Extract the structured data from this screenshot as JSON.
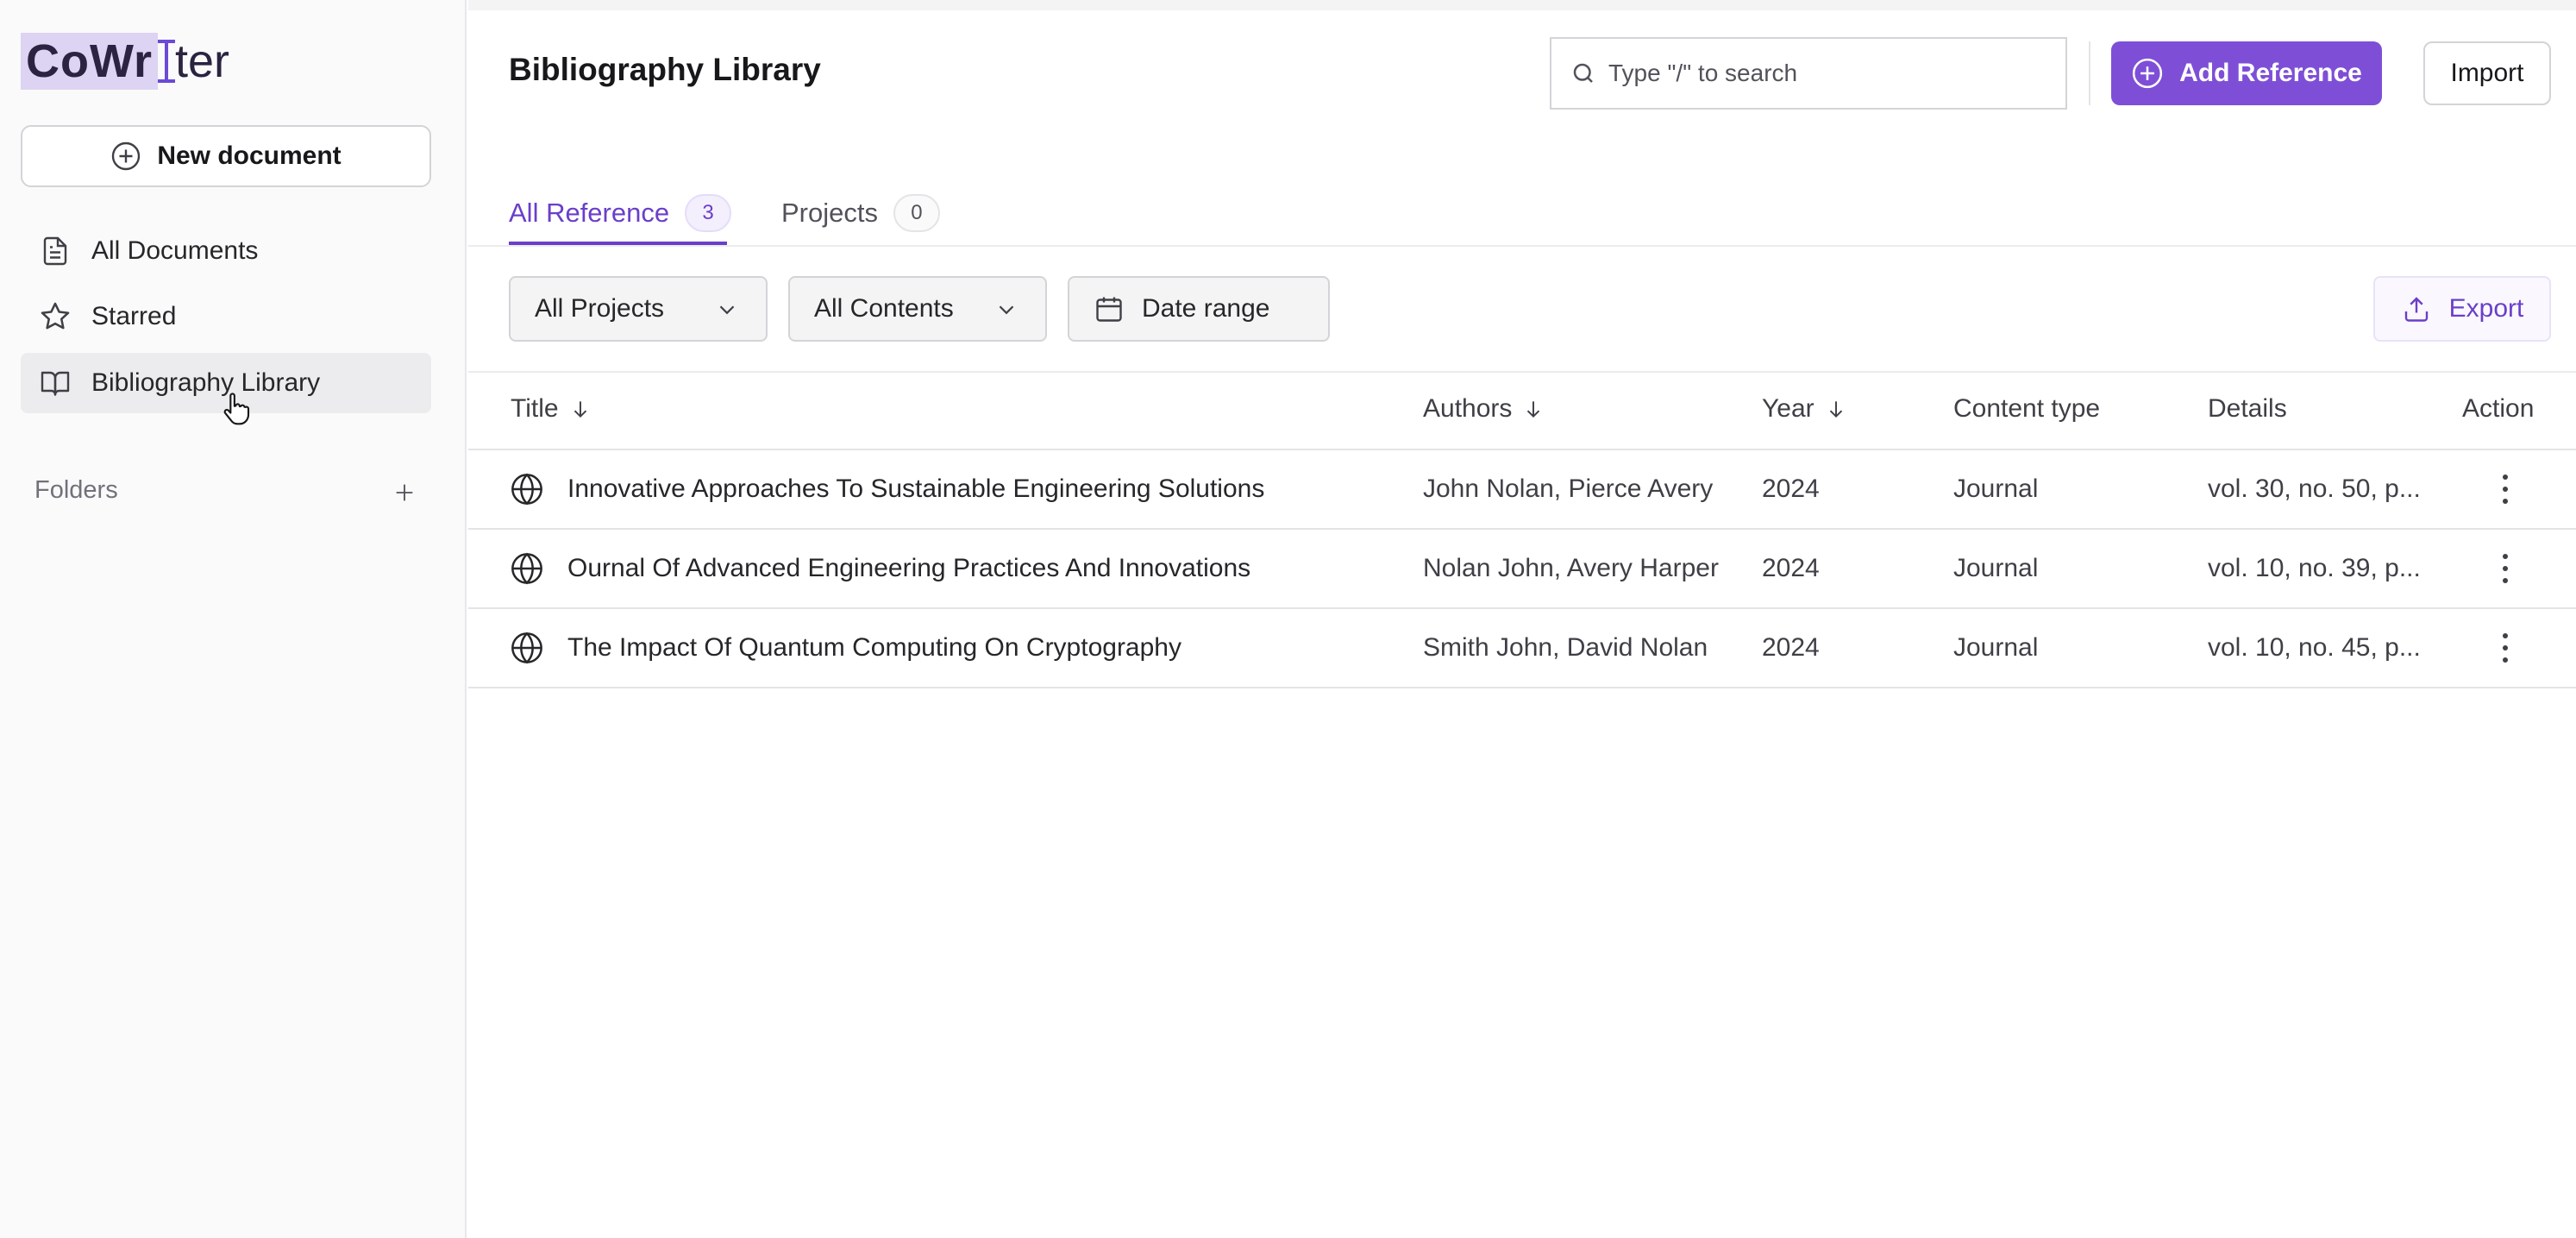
{
  "app": {
    "logo_highlight": "CoWr",
    "logo_rest": "ter"
  },
  "sidebar": {
    "new_document": "New document",
    "items": [
      {
        "label": "All Documents",
        "icon": "document-icon"
      },
      {
        "label": "Starred",
        "icon": "star-icon"
      },
      {
        "label": "Bibliography Library",
        "icon": "book-icon",
        "active": true
      }
    ],
    "folders_label": "Folders"
  },
  "header": {
    "title": "Bibliography Library",
    "search_placeholder": "Type \"/\" to search",
    "add_reference": "Add Reference",
    "import": "Import"
  },
  "tabs": [
    {
      "label": "All Reference",
      "count": "3",
      "active": true
    },
    {
      "label": "Projects",
      "count": "0",
      "active": false
    }
  ],
  "filters": {
    "projects": "All Projects",
    "contents": "All Contents",
    "date_range": "Date range",
    "export": "Export"
  },
  "table": {
    "columns": {
      "title": "Title",
      "authors": "Authors",
      "year": "Year",
      "content_type": "Content type",
      "details": "Details",
      "action": "Action"
    },
    "rows": [
      {
        "title": "Innovative Approaches To Sustainable Engineering Solutions",
        "authors": "John Nolan, Pierce Avery",
        "year": "2024",
        "content_type": "Journal",
        "details": "vol. 30, no. 50, p..."
      },
      {
        "title": "Ournal Of Advanced Engineering Practices And Innovations",
        "authors": "Nolan John, Avery Harper",
        "year": "2024",
        "content_type": "Journal",
        "details": "vol. 10, no. 39, p..."
      },
      {
        "title": "The Impact Of Quantum Computing On Cryptography",
        "authors": "Smith John, David Nolan",
        "year": "2024",
        "content_type": "Journal",
        "details": "vol. 10, no. 45, p..."
      }
    ]
  },
  "colors": {
    "accent": "#7e4fd6",
    "accent_text": "#6a3fc9"
  }
}
